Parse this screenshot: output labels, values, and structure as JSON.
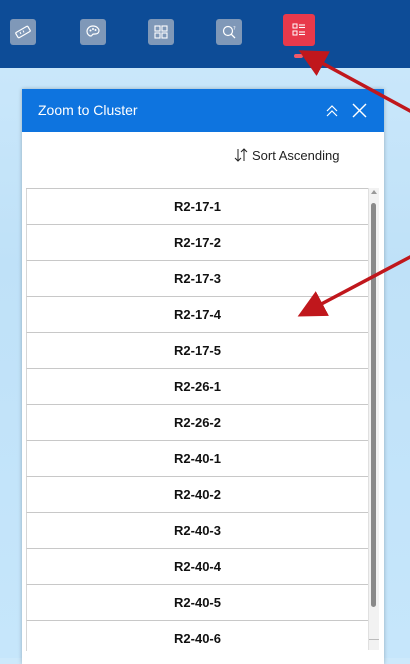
{
  "toolbar": {
    "tools": [
      {
        "icon": "ruler-icon"
      },
      {
        "icon": "palette-icon"
      },
      {
        "icon": "grid-icon"
      },
      {
        "icon": "query-icon"
      },
      {
        "icon": "list-icon",
        "active": true
      }
    ],
    "accent": "#e8394b",
    "background": "#0d4c97"
  },
  "panel": {
    "title": "Zoom to Cluster",
    "sort_label": "Sort Ascending",
    "header_color": "#0e74df",
    "items": [
      "R2-17-1",
      "R2-17-2",
      "R2-17-3",
      "R2-17-4",
      "R2-17-5",
      "R2-26-1",
      "R2-26-2",
      "R2-40-1",
      "R2-40-2",
      "R2-40-3",
      "R2-40-4",
      "R2-40-5",
      "R2-40-6"
    ]
  },
  "annotation_color": "#c0171c"
}
